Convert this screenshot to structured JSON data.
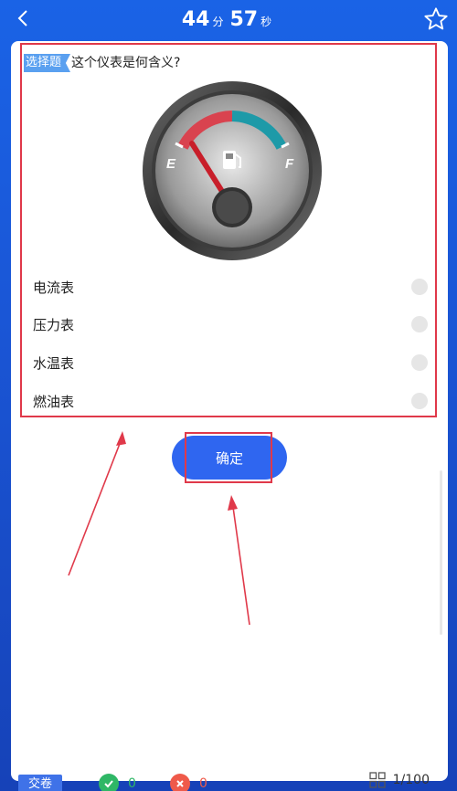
{
  "header": {
    "minutes": "44",
    "minutes_unit": "分",
    "seconds": "57",
    "seconds_unit": "秒"
  },
  "question": {
    "tag": "选择题",
    "text": "这个仪表是何含义?",
    "gauge_labels": {
      "empty": "E",
      "full": "F"
    },
    "options": [
      {
        "label": "电流表"
      },
      {
        "label": "压力表"
      },
      {
        "label": "水温表"
      },
      {
        "label": "燃油表"
      }
    ]
  },
  "confirm": {
    "label": "确定"
  },
  "footer": {
    "submit_label": "交卷",
    "correct_count": "0",
    "wrong_count": "0",
    "progress": "1/100"
  },
  "colors": {
    "primary": "#2f66f0",
    "highlight_red": "#e0394a",
    "correct_green": "#2fb766",
    "wrong_red": "#ef5a4a"
  }
}
